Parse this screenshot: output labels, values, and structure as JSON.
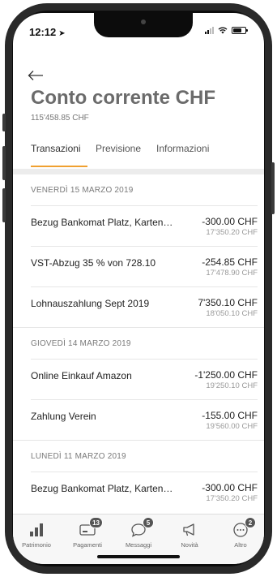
{
  "status_bar": {
    "time": "12:12"
  },
  "header": {
    "title": "Conto corrente CHF",
    "balance": "115'458.85 CHF"
  },
  "tabs": [
    {
      "label": "Transazioni",
      "active": true
    },
    {
      "label": "Previsione",
      "active": false
    },
    {
      "label": "Informazioni",
      "active": false
    }
  ],
  "sections": [
    {
      "date": "VENERDÌ 15 MARZO 2019",
      "transactions": [
        {
          "name": "Bezug Bankomat Platz, Karten…",
          "amount": "-300.00 CHF",
          "balance": "17'350.20 CHF"
        },
        {
          "name": "VST-Abzug 35 % von 728.10",
          "amount": "-254.85 CHF",
          "balance": "17'478.90 CHF"
        },
        {
          "name": "Lohnauszahlung Sept 2019",
          "amount": "7'350.10 CHF",
          "balance": "18'050.10 CHF"
        }
      ]
    },
    {
      "date": "GIOVEDÌ 14 MARZO 2019",
      "transactions": [
        {
          "name": "Online Einkauf Amazon",
          "amount": "-1'250.00 CHF",
          "balance": "19'250.10 CHF"
        },
        {
          "name": "Zahlung Verein",
          "amount": "-155.00 CHF",
          "balance": "19'560.00 CHF"
        }
      ]
    },
    {
      "date": "LUNEDÌ 11 MARZO 2019",
      "transactions": [
        {
          "name": "Bezug Bankomat Platz, Karten…",
          "amount": "-300.00 CHF",
          "balance": "17'350.20 CHF"
        }
      ]
    }
  ],
  "bottom_nav": [
    {
      "label": "Patrimonio",
      "icon": "bar-chart-icon",
      "badge": ""
    },
    {
      "label": "Pagamenti",
      "icon": "payments-icon",
      "badge": "13"
    },
    {
      "label": "Messaggi",
      "icon": "chat-bubble-icon",
      "badge": "5"
    },
    {
      "label": "Novità",
      "icon": "megaphone-icon",
      "badge": ""
    },
    {
      "label": "Altro",
      "icon": "more-icon",
      "badge": "2"
    }
  ],
  "colors": {
    "accent": "#f0a030",
    "title": "#6b6b6b",
    "badge": "#555555"
  }
}
